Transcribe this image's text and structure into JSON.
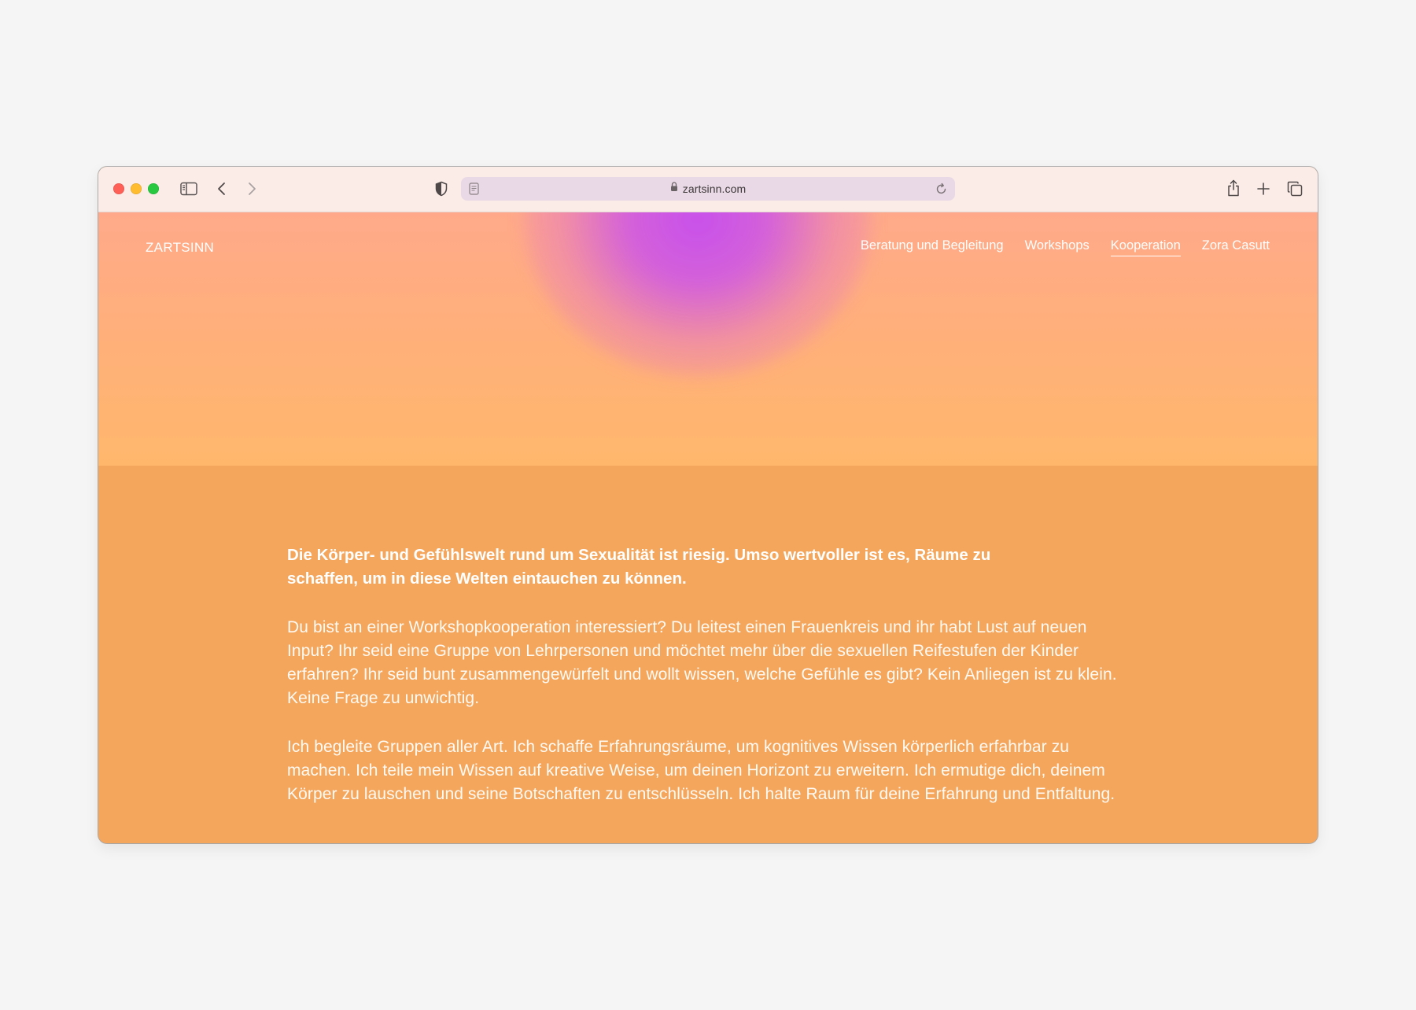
{
  "browser": {
    "url": "zartsinn.com"
  },
  "site": {
    "logo": "ZARTSINN",
    "nav": [
      {
        "label": "Beratung und Begleitung",
        "active": false
      },
      {
        "label": "Workshops",
        "active": false
      },
      {
        "label": "Kooperation",
        "active": true
      },
      {
        "label": "Zora Casutt",
        "active": false
      }
    ]
  },
  "content": {
    "lead": "Die Körper- und Gefühlswelt rund um Sexualität ist riesig. Umso wertvoller ist es, Räume zu schaffen, um in diese Welten eintauchen zu können.",
    "paragraph_1": "Du bist an einer Workshopkooperation interessiert? Du leitest einen Frauenkreis und ihr habt Lust auf neuen Input? Ihr seid eine Gruppe von Lehrpersonen und möchtet mehr über die sexuellen Reifestufen der Kinder erfahren? Ihr seid bunt zusammengewürfelt und wollt wissen, welche Gefühle es gibt? Kein Anliegen ist zu klein. Keine Frage zu unwichtig.",
    "paragraph_2": "Ich begleite Gruppen aller Art. Ich schaffe Erfahrungsräume, um kognitives Wissen körperlich erfahrbar zu machen. Ich teile mein Wissen auf kreative Weise, um deinen Horizont zu erweitern. Ich ermutige dich, deinem Körper zu lauschen und seine Botschaften zu entschlüsseln. Ich halte Raum für deine Erfahrung und Entfaltung."
  },
  "colors": {
    "hero_top": "#ffa98a",
    "hero_bottom": "#ffb76c",
    "body_bg": "#f5a65d",
    "glow": "#c850eb",
    "toolbar_bg": "#fbece7"
  },
  "icons": {
    "sidebar": "sidebar-icon",
    "back": "chevron-left-icon",
    "forward": "chevron-right-icon",
    "privacy": "shield-icon",
    "page": "page-icon",
    "lock": "lock-icon",
    "reload": "reload-icon",
    "share": "share-icon",
    "new_tab": "plus-icon",
    "tabs": "tabs-overview-icon"
  }
}
